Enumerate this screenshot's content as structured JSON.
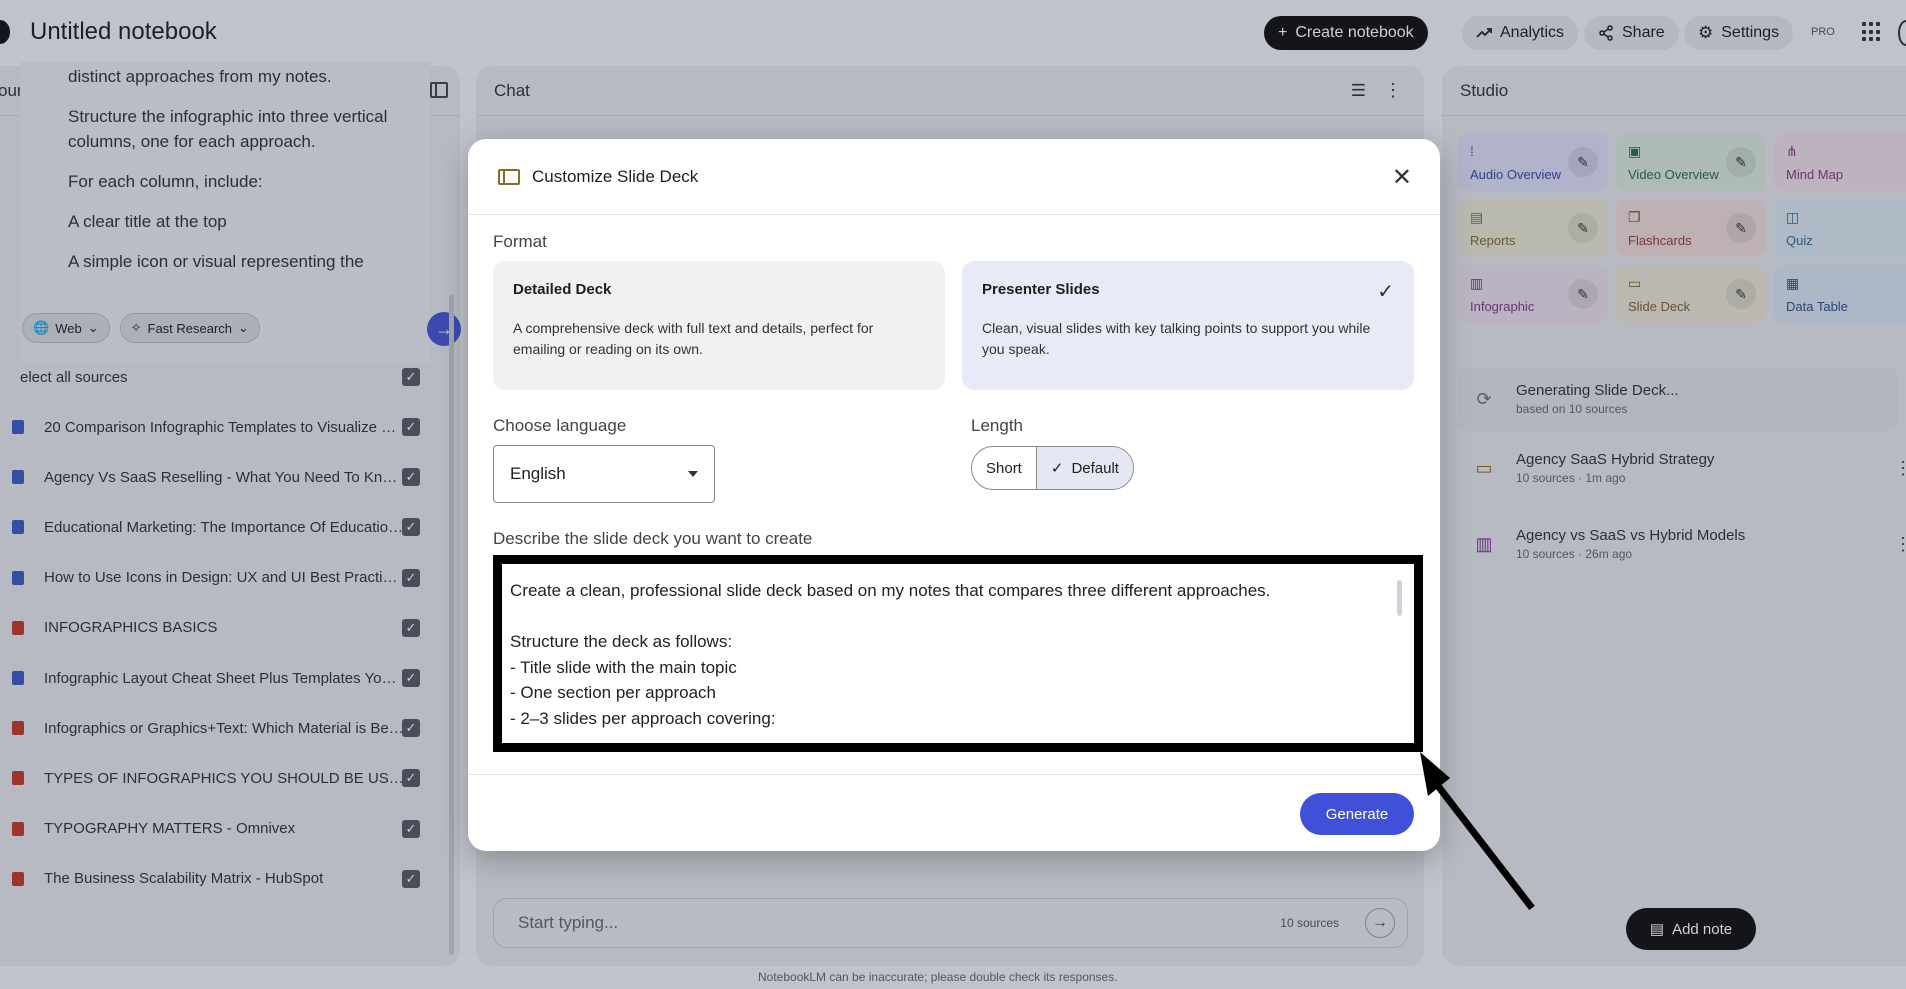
{
  "header": {
    "title": "Untitled notebook",
    "create_label": "Create notebook",
    "analytics_label": "Analytics",
    "share_label": "Share",
    "settings_label": "Settings",
    "pro_badge": "PRO"
  },
  "sources": {
    "title": "ources",
    "prompt_lines": [
      "distinct approaches from my notes.",
      "Structure the infographic into three vertical columns, one for each approach.",
      "For each column, include:",
      "A clear title at the top",
      "A simple icon or visual representing the"
    ],
    "web_chip": "Web",
    "research_chip": "Fast Research",
    "select_all": "elect all sources",
    "items": [
      {
        "label": "20 Comparison Infographic Templates to Visualize Pr...",
        "type": "web"
      },
      {
        "label": "Agency Vs SaaS Reselling - What You Need To Know :...",
        "type": "web"
      },
      {
        "label": "Educational Marketing: The Importance Of Education...",
        "type": "web"
      },
      {
        "label": "How to Use Icons in Design: UX and UI Best Practices...",
        "type": "web"
      },
      {
        "label": "INFOGRAPHICS BASICS",
        "type": "pdf"
      },
      {
        "label": "Infographic Layout Cheat Sheet Plus Templates You ...",
        "type": "web"
      },
      {
        "label": "Infographics or Graphics+Text: Which Material is Bes...",
        "type": "pdf"
      },
      {
        "label": "TYPES OF INFOGRAPHICS YOU SHOULD BE USING I...",
        "type": "pdf"
      },
      {
        "label": "TYPOGRAPHY MATTERS - Omnivex",
        "type": "pdf"
      },
      {
        "label": "The Business Scalability Matrix - HubSpot",
        "type": "pdf"
      }
    ]
  },
  "chat": {
    "title": "Chat",
    "input_placeholder": "Start typing...",
    "source_count": "10 sources",
    "disclaimer": "NotebookLM can be inaccurate; please double check its responses."
  },
  "studio": {
    "title": "Studio",
    "tiles": [
      {
        "label": "Audio Overview",
        "icon": "waveform-icon",
        "color": "#d9dcf2",
        "text_color": "#3947a8"
      },
      {
        "label": "Video Overview",
        "icon": "video-icon",
        "color": "#d6e6dc",
        "text_color": "#2f6b47"
      },
      {
        "label": "Mind Map",
        "icon": "mindmap-icon",
        "color": "#e8dbe6",
        "text_color": "#8a3a7c"
      },
      {
        "label": "Reports",
        "icon": "report-icon",
        "color": "#e6e3d3",
        "text_color": "#7a6b3a"
      },
      {
        "label": "Flashcards",
        "icon": "flashcards-icon",
        "color": "#ead9d8",
        "text_color": "#9a3a3a"
      },
      {
        "label": "Quiz",
        "icon": "quiz-icon",
        "color": "#d7e4ee",
        "text_color": "#2f6a93"
      },
      {
        "label": "Infographic",
        "icon": "infographic-icon",
        "color": "#e6dbe8",
        "text_color": "#7a3a8a"
      },
      {
        "label": "Slide Deck",
        "icon": "slides-icon",
        "color": "#e6e2d3",
        "text_color": "#7a6433"
      },
      {
        "label": "Data Table",
        "icon": "table-icon",
        "color": "#d7e1ee",
        "text_color": "#2f4f8a"
      }
    ],
    "items": [
      {
        "title": "Generating Slide Deck...",
        "sub": "based on 10 sources",
        "icon": "sync-icon"
      },
      {
        "title": "Agency SaaS Hybrid Strategy",
        "sub": "10 sources · 1m ago",
        "icon": "slides-icon"
      },
      {
        "title": "Agency vs SaaS vs Hybrid Models",
        "sub": "10 sources · 26m ago",
        "icon": "infographic-icon"
      }
    ],
    "add_note": "Add note"
  },
  "modal": {
    "title": "Customize Slide Deck",
    "format_label": "Format",
    "formats": [
      {
        "title": "Detailed Deck",
        "desc": "A comprehensive deck with full text and details, perfect for emailing or reading on its own.",
        "selected": false
      },
      {
        "title": "Presenter Slides",
        "desc": "Clean, visual slides with key talking points to support you while you speak.",
        "selected": true
      }
    ],
    "language_label": "Choose language",
    "language_value": "English",
    "length_label": "Length",
    "length_options": [
      "Short",
      "Default"
    ],
    "length_selected": "Default",
    "describe_label": "Describe the slide deck you want to create",
    "describe_lines": [
      "Create a clean, professional slide deck based on my notes that compares three different approaches.",
      "",
      "Structure the deck as follows:",
      "- Title slide with the main topic",
      "- One section per approach",
      "- 2–3 slides per approach covering:"
    ],
    "generate_label": "Generate"
  },
  "colors": {
    "accent": "#3f51d9",
    "pdf_icon": "#c0392b",
    "web_icon": "#3a5bbf"
  }
}
